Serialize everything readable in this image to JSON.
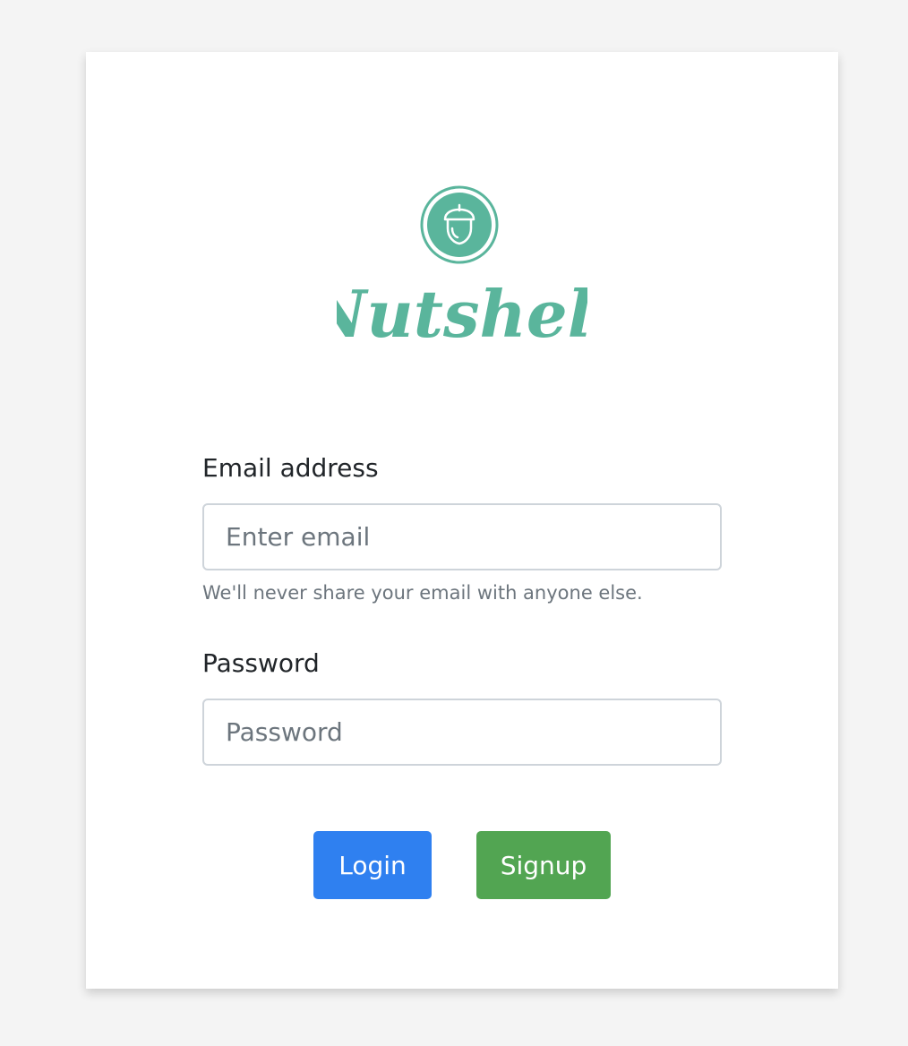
{
  "brand": {
    "name": "Nutshell",
    "color": "#5ab59c"
  },
  "form": {
    "email_label": "Email address",
    "email_value": "",
    "email_placeholder": "Enter email",
    "email_help": "We'll never share your email with anyone else.",
    "password_label": "Password",
    "password_value": "",
    "password_placeholder": "Password"
  },
  "actions": {
    "login_label": "Login",
    "login_color": "#2f80f0",
    "signup_label": "Signup",
    "signup_color": "#52a552"
  },
  "icons": {
    "logo": "acorn-icon"
  }
}
